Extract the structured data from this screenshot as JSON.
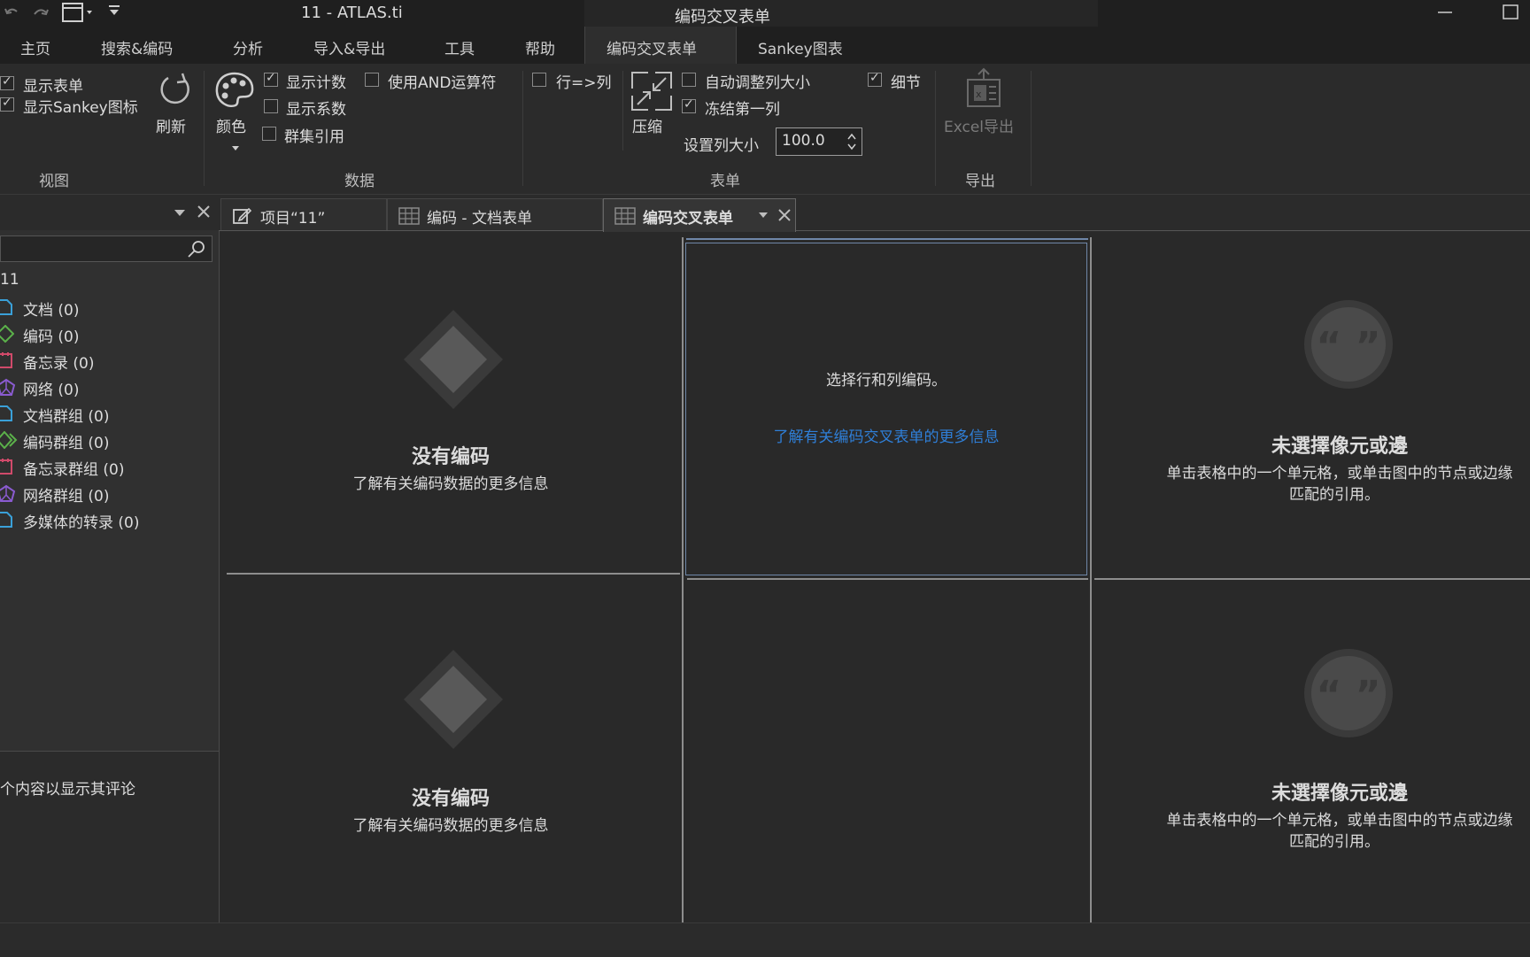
{
  "window": {
    "app_title": "11 - ATLAS.ti",
    "context_title": "编码交叉表单"
  },
  "ribbon_tabs": [
    "主页",
    "搜索&编码",
    "分析",
    "导入&导出",
    "工具",
    "帮助",
    "编码交叉表单",
    "Sankey图表"
  ],
  "ribbon": {
    "view": {
      "show_table": "显示表单",
      "show_sankey": "显示Sankey图标",
      "refresh": "刷新",
      "group_label": "视图"
    },
    "data": {
      "color": "颜色",
      "show_count": "显示计数",
      "use_and": "使用AND运算符",
      "show_coeff": "显示系数",
      "cluster_quotes": "群集引用",
      "group_label": "数据"
    },
    "table": {
      "row_to_col": "行=>列",
      "compress": "压缩",
      "auto_resize": "自动调整列大小",
      "freeze_first": "冻结第一列",
      "set_col_size": "设置列大小",
      "col_size_value": "100.0",
      "detail": "细节",
      "group_label": "表单"
    },
    "export": {
      "excel_export": "Excel导出",
      "group_label": "导出"
    }
  },
  "left_panel": {
    "root": "11",
    "items": [
      {
        "label": "文档 (0)",
        "color": "#3aa0d8"
      },
      {
        "label": "编码 (0)",
        "color": "#5bb14a"
      },
      {
        "label": "备忘录 (0)",
        "color": "#d04a6a"
      },
      {
        "label": "网络 (0)",
        "color": "#8a5bd0"
      },
      {
        "label": "文档群组 (0)",
        "color": "#3aa0d8"
      },
      {
        "label": "编码群组 (0)",
        "color": "#5bb14a"
      },
      {
        "label": "备忘录群组 (0)",
        "color": "#d04a6a"
      },
      {
        "label": "网络群组 (0)",
        "color": "#8a5bd0"
      },
      {
        "label": "多媒体的转录 (0)",
        "color": "#3aa0d8"
      }
    ],
    "comment_hint": "个内容以显示其评论"
  },
  "doc_tabs": [
    {
      "label": "项目“11”"
    },
    {
      "label": "编码 - 文档表单"
    },
    {
      "label": "编码交叉表单"
    }
  ],
  "panes": {
    "no_codes_title": "没有编码",
    "no_codes_link": "了解有关编码数据的更多信息",
    "select_codes": "选择行和列编码。",
    "learn_more_link": "了解有关编码交叉表单的更多信息",
    "link_color": "#2f7fd8",
    "no_selection_title": "未選擇像元或邊",
    "no_selection_line1": "单击表格中的一个单元格，或单击图中的节点或边缘",
    "no_selection_line2": "匹配的引用。"
  }
}
